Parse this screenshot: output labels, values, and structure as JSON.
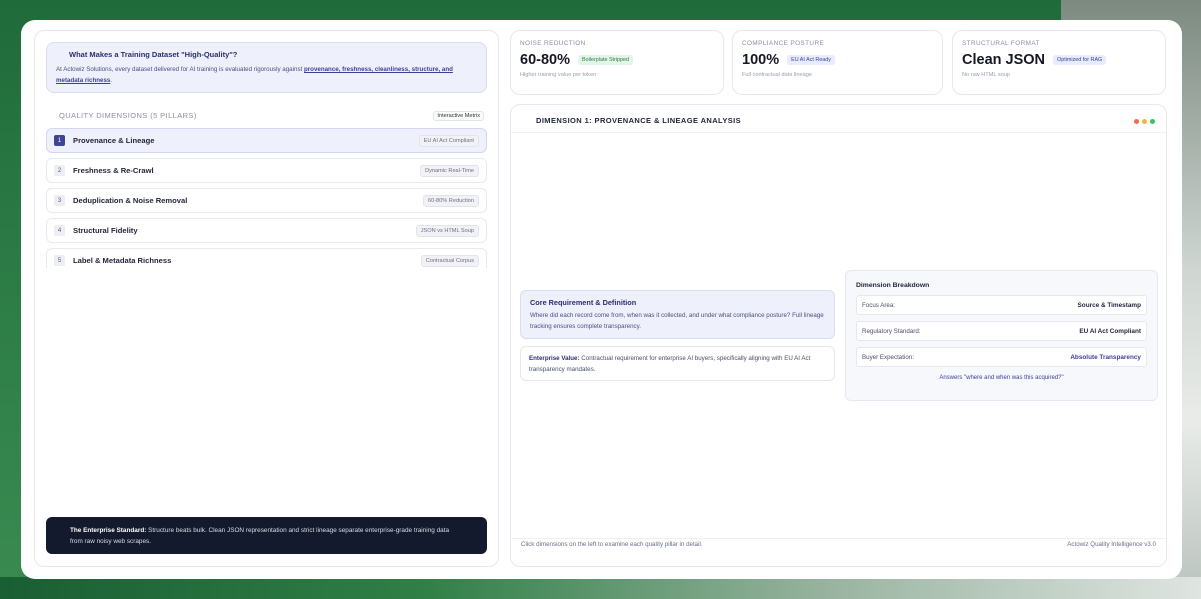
{
  "intro": {
    "title": "What Makes a Training Dataset \"High-Quality\"?",
    "body_prefix": "At Actowiz Solutions, every dataset delivered for AI training is evaluated rigorously against ",
    "body_links": "provenance, freshness, cleanliness, structure, and metadata richness",
    "body_suffix": "."
  },
  "dimensions": {
    "heading": "QUALITY DIMENSIONS (5 PILLARS)",
    "badge": "Interactive Metrix",
    "items": [
      {
        "num": "1",
        "label": "Provenance & Lineage",
        "tag": "EU AI Act Compliant"
      },
      {
        "num": "2",
        "label": "Freshness & Re-Crawl",
        "tag": "Dynamic Real-Time"
      },
      {
        "num": "3",
        "label": "Deduplication & Noise Removal",
        "tag": "60-80% Reduction"
      },
      {
        "num": "4",
        "label": "Structural Fidelity",
        "tag": "JSON vs HTML Soup"
      },
      {
        "num": "5",
        "label": "Label & Metadata Richness",
        "tag": "Contractual Corpus"
      }
    ]
  },
  "enterprise": {
    "bold": "The Enterprise Standard:",
    "text": " Structure beats bulk. Clean JSON representation and strict lineage separate enterprise-grade training data from raw noisy web scrapes."
  },
  "cards": [
    {
      "label": "NOISE REDUCTION",
      "value": "60-80%",
      "badge": "Boilerplate Stripped",
      "sub": "Higher training value per token"
    },
    {
      "label": "COMPLIANCE POSTURE",
      "value": "100%",
      "badge": "EU AI Act Ready",
      "sub": "Full contractual data lineage"
    },
    {
      "label": "STRUCTURAL FORMAT",
      "value": "Clean JSON",
      "badge": "Optimized for RAG",
      "sub": "No raw HTML soup"
    }
  ],
  "analysis": {
    "title": "DIMENSION 1: PROVENANCE & LINEAGE ANALYSIS",
    "core_title": "Core Requirement & Definition",
    "core_body": "Where did each record come from, when was it collected, and under what compliance posture? Full lineage tracking ensures complete transparency.",
    "value_bold": "Enterprise Value:",
    "value_text": " Contractual requirement for enterprise AI buyers, specifically aligning with EU AI Act transparency mandates.",
    "breakdown_title": "Dimension Breakdown",
    "breakdown": [
      {
        "key": "Focus Area:",
        "val": "Source & Timestamp"
      },
      {
        "key": "Regulatory Standard:",
        "val": "EU AI Act Compliant"
      },
      {
        "key": "Buyer Expectation:",
        "val": "Absolute Transparency"
      }
    ],
    "breakdown_foot": "Answers \"where and when was this acquired?\"",
    "footer_left": "Click dimensions on the left to examine each quality pillar in detail.",
    "footer_right": "Actowiz Quality Intelligence v3.0"
  },
  "colors": {
    "accent": "#3f4593",
    "dot_red": "#f06a4f",
    "dot_yellow": "#f3b43a",
    "dot_green": "#3fbf66"
  }
}
